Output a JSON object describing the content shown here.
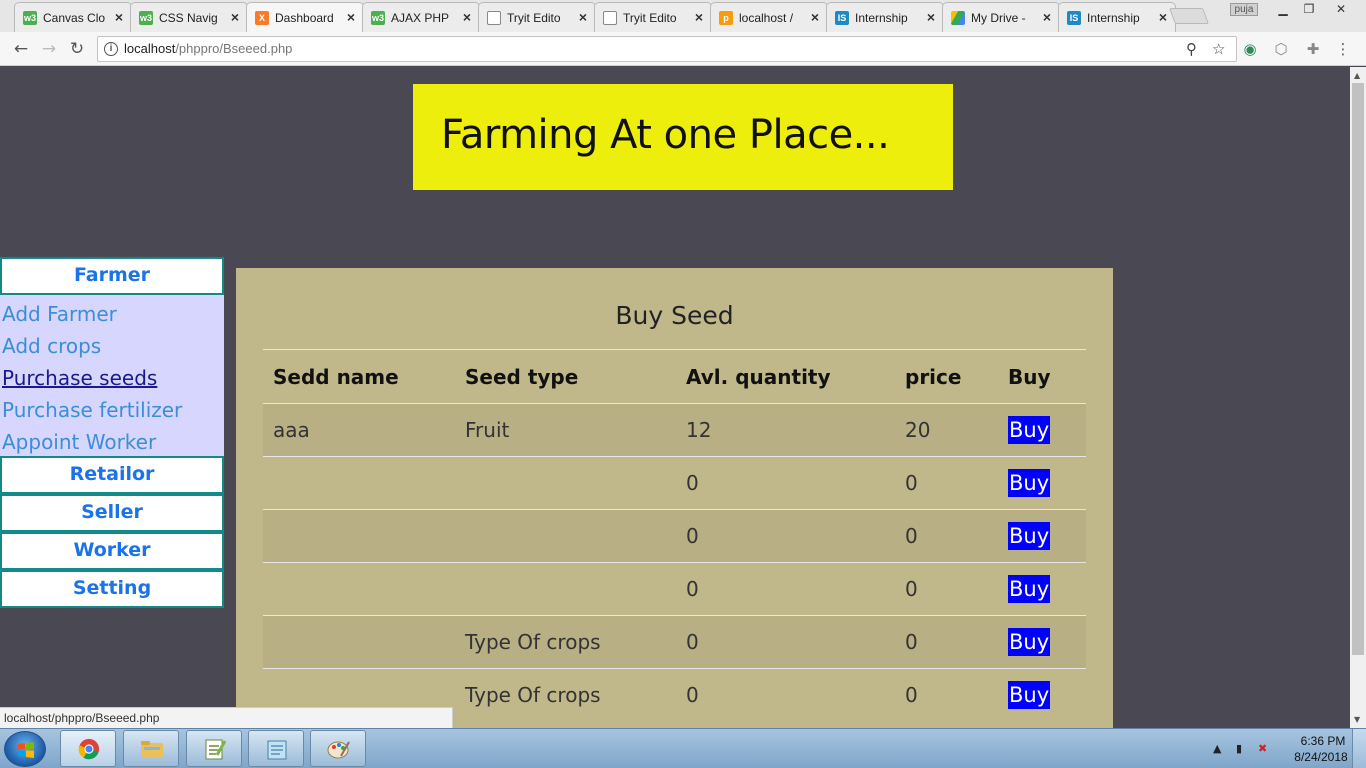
{
  "browser": {
    "tabs": [
      {
        "title": "Canvas Clo",
        "favicon": "w3schools-icon",
        "favicon_color": "#4caf50"
      },
      {
        "title": "CSS Navig",
        "favicon": "w3schools-icon",
        "favicon_color": "#4caf50"
      },
      {
        "title": "Dashboard",
        "favicon": "xampp-icon",
        "favicon_color": "#fb7a24",
        "active": true
      },
      {
        "title": "AJAX PHP",
        "favicon": "w3schools-icon",
        "favicon_color": "#4caf50"
      },
      {
        "title": "Tryit Edito",
        "favicon": "page-icon",
        "favicon_color": "#ffffff"
      },
      {
        "title": "Tryit Edito",
        "favicon": "page-icon",
        "favicon_color": "#ffffff"
      },
      {
        "title": "localhost /",
        "favicon": "phpmyadmin-icon",
        "favicon_color": "#f89c0e"
      },
      {
        "title": "Internship",
        "favicon": "internshala-icon",
        "favicon_color": "#1f8ac0"
      },
      {
        "title": "My Drive -",
        "favicon": "google-drive-icon",
        "favicon_color": "#34a853"
      },
      {
        "title": "Internship",
        "favicon": "internshala-icon",
        "favicon_color": "#1f8ac0"
      }
    ],
    "user_badge": "puja",
    "url_host": "localhost",
    "url_path": "/phppro/Bseeed.php",
    "status_url": "localhost/phppro/Bseeed.php"
  },
  "page": {
    "banner_title": "Farming At one Place...",
    "nav": {
      "farmer": "Farmer",
      "farmer_links": [
        "Add Farmer",
        "Add crops",
        "Purchase seeds",
        "Purchase fertilizer",
        "Appoint Worker"
      ],
      "retailor": "Retailor",
      "seller": "Seller",
      "worker": "Worker",
      "setting": "Setting"
    },
    "panel_title": "Buy Seed",
    "table": {
      "headers": [
        "Sedd name",
        "Seed type",
        "Avl. quantity",
        "price",
        "Buy"
      ],
      "rows": [
        {
          "name": "aaa",
          "type": "Fruit",
          "qty": "12",
          "price": "20",
          "buy": "Buy"
        },
        {
          "name": "",
          "type": "",
          "qty": "0",
          "price": "0",
          "buy": "Buy"
        },
        {
          "name": "",
          "type": "",
          "qty": "0",
          "price": "0",
          "buy": "Buy"
        },
        {
          "name": "",
          "type": "",
          "qty": "0",
          "price": "0",
          "buy": "Buy"
        },
        {
          "name": "",
          "type": "Type Of crops",
          "qty": "0",
          "price": "0",
          "buy": "Buy"
        },
        {
          "name": "",
          "type": "Type Of crops",
          "qty": "0",
          "price": "0",
          "buy": "Buy"
        }
      ]
    },
    "colors": {
      "page_bg": "#4a4852",
      "banner_bg": "#eeee0c",
      "panel_bg": "#c0b88a",
      "nav_sub_bg": "#d6d6ff",
      "nav_link": "#3c8ed9",
      "buy_button": "#0000ff"
    }
  },
  "taskbar": {
    "apps": [
      "chrome-icon",
      "file-explorer-icon",
      "notepad-plus-icon",
      "notepad-icon",
      "paint-icon"
    ],
    "clock_time": "6:36 PM",
    "clock_date": "8/24/2018"
  }
}
